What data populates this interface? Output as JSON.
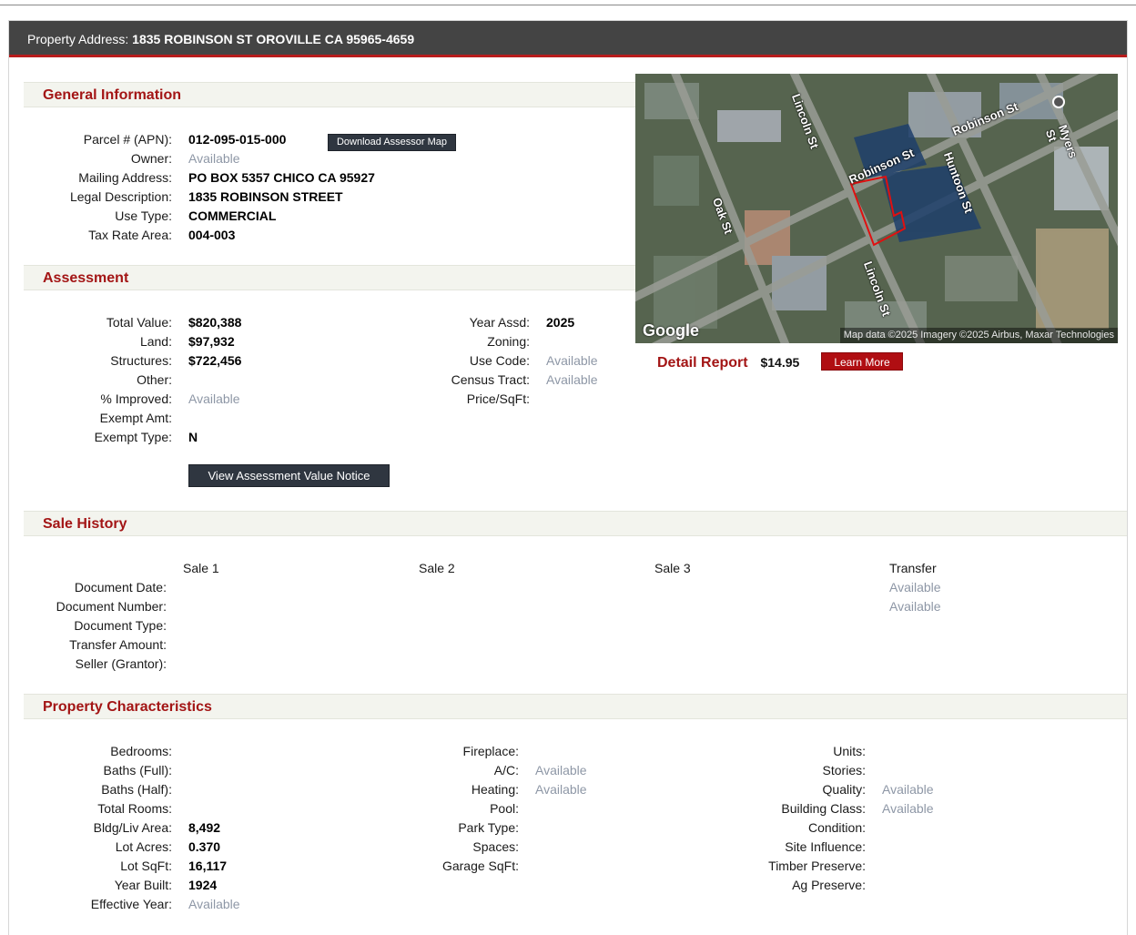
{
  "title": {
    "label": "Property Address:",
    "address": "1835 ROBINSON ST OROVILLE CA 95965-4659"
  },
  "general": {
    "heading": "General Information",
    "download_button": "Download Assessor Map",
    "fields": [
      {
        "label": "Parcel # (APN):",
        "value": "012-095-015-000",
        "kind": "bold"
      },
      {
        "label": "Owner:",
        "value": "Available",
        "kind": "avail"
      },
      {
        "label": "Mailing Address:",
        "value": "PO BOX 5357 CHICO CA 95927",
        "kind": "bold"
      },
      {
        "label": "Legal Description:",
        "value": "1835 ROBINSON STREET",
        "kind": "bold"
      },
      {
        "label": "Use Type:",
        "value": "COMMERCIAL",
        "kind": "bold"
      },
      {
        "label": "Tax Rate Area:",
        "value": "004-003",
        "kind": "bold"
      }
    ]
  },
  "map": {
    "streets": [
      "Lincoln St",
      "Robinson St",
      "Robinson St",
      "Myers St",
      "Huntoon St",
      "Oak St",
      "Lincoln St"
    ],
    "logo": "Google",
    "attribution": "Map data ©2025 Imagery ©2025 Airbus, Maxar Technologies",
    "parcel_color": "#e01010"
  },
  "detail": {
    "label": "Detail Report",
    "price": "$14.95",
    "button": "Learn More"
  },
  "assessment": {
    "heading": "Assessment",
    "left": [
      {
        "label": "Total Value:",
        "value": "$820,388",
        "kind": "bold"
      },
      {
        "label": "Land:",
        "value": "$97,932",
        "kind": "bold"
      },
      {
        "label": "Structures:",
        "value": "$722,456",
        "kind": "bold"
      },
      {
        "label": "Other:",
        "value": "",
        "kind": "bold"
      },
      {
        "label": "% Improved:",
        "value": "Available",
        "kind": "avail"
      },
      {
        "label": "Exempt Amt:",
        "value": "",
        "kind": "bold"
      },
      {
        "label": "Exempt Type:",
        "value": "N",
        "kind": "bold"
      }
    ],
    "right": [
      {
        "label": "Year Assd:",
        "value": "2025",
        "kind": "bold"
      },
      {
        "label": "Zoning:",
        "value": "",
        "kind": "bold"
      },
      {
        "label": "Use Code:",
        "value": "Available",
        "kind": "avail"
      },
      {
        "label": "Census Tract:",
        "value": "Available",
        "kind": "avail"
      },
      {
        "label": "Price/SqFt:",
        "value": "",
        "kind": "bold"
      }
    ],
    "notice_button": "View Assessment Value Notice"
  },
  "sales": {
    "heading": "Sale History",
    "columns": [
      "Sale 1",
      "Sale 2",
      "Sale 3",
      "Transfer"
    ],
    "rows": [
      "Document Date:",
      "Document Number:",
      "Document Type:",
      "Transfer Amount:",
      "Seller (Grantor):"
    ],
    "transfer_values": [
      "Available",
      "Available"
    ]
  },
  "characteristics": {
    "heading": "Property Characteristics",
    "col1": [
      {
        "label": "Bedrooms:",
        "value": "",
        "kind": "bold"
      },
      {
        "label": "Baths (Full):",
        "value": "",
        "kind": "bold"
      },
      {
        "label": "Baths (Half):",
        "value": "",
        "kind": "bold"
      },
      {
        "label": "Total Rooms:",
        "value": "",
        "kind": "bold"
      },
      {
        "label": "Bldg/Liv Area:",
        "value": "8,492",
        "kind": "bold"
      },
      {
        "label": "Lot Acres:",
        "value": "0.370",
        "kind": "bold"
      },
      {
        "label": "Lot SqFt:",
        "value": "16,117",
        "kind": "bold"
      },
      {
        "label": "Year Built:",
        "value": "1924",
        "kind": "bold"
      },
      {
        "label": "Effective Year:",
        "value": "Available",
        "kind": "avail"
      }
    ],
    "col2": [
      {
        "label": "Fireplace:",
        "value": "",
        "kind": "bold"
      },
      {
        "label": "A/C:",
        "value": "Available",
        "kind": "avail"
      },
      {
        "label": "Heating:",
        "value": "Available",
        "kind": "avail"
      },
      {
        "label": "Pool:",
        "value": "",
        "kind": "bold"
      },
      {
        "label": "Park Type:",
        "value": "",
        "kind": "bold"
      },
      {
        "label": "Spaces:",
        "value": "",
        "kind": "bold"
      },
      {
        "label": "Garage SqFt:",
        "value": "",
        "kind": "bold"
      }
    ],
    "col3": [
      {
        "label": "Units:",
        "value": "",
        "kind": "bold"
      },
      {
        "label": "Stories:",
        "value": "",
        "kind": "bold"
      },
      {
        "label": "Quality:",
        "value": "Available",
        "kind": "avail"
      },
      {
        "label": "Building Class:",
        "value": "Available",
        "kind": "avail"
      },
      {
        "label": "Condition:",
        "value": "",
        "kind": "bold"
      },
      {
        "label": "Site Influence:",
        "value": "",
        "kind": "bold"
      },
      {
        "label": "Timber Preserve:",
        "value": "",
        "kind": "bold"
      },
      {
        "label": "Ag Preserve:",
        "value": "",
        "kind": "bold"
      }
    ]
  }
}
